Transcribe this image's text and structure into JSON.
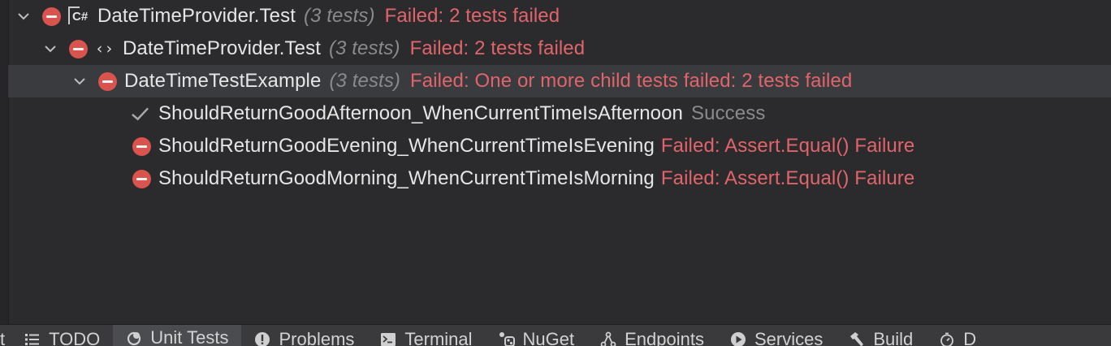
{
  "tree": {
    "rows": [
      {
        "name": "DateTimeProvider.Test",
        "count": "(3 tests)",
        "status": "Failed: 2 tests failed",
        "icon": "csharp-project-icon"
      },
      {
        "name": "DateTimeProvider.Test",
        "count": "(3 tests)",
        "status": "Failed: 2 tests failed",
        "icon": "namespace-icon"
      },
      {
        "name": "DateTimeTestExample",
        "count": "(3 tests)",
        "status": "Failed: One or more child tests failed: 2 tests failed",
        "selected": true
      },
      {
        "name": "ShouldReturnGoodAfternoon_WhenCurrentTimeIsAfternoon",
        "status": "Success",
        "result": "pass"
      },
      {
        "name": "ShouldReturnGoodEvening_WhenCurrentTimeIsEvening",
        "status": "Failed: Assert.Equal() Failure",
        "result": "fail"
      },
      {
        "name": "ShouldReturnGoodMorning_WhenCurrentTimeIsMorning",
        "status": "Failed: Assert.Equal() Failure",
        "result": "fail"
      }
    ]
  },
  "statusbar": {
    "cut_left": "t",
    "tools": [
      {
        "label": "TODO",
        "icon": "list-icon"
      },
      {
        "label": "Unit Tests",
        "icon": "unit-tests-icon",
        "active": true
      },
      {
        "label": "Problems",
        "icon": "problems-icon"
      },
      {
        "label": "Terminal",
        "icon": "terminal-icon"
      },
      {
        "label": "NuGet",
        "icon": "nuget-icon"
      },
      {
        "label": "Endpoints",
        "icon": "endpoints-icon"
      },
      {
        "label": "Services",
        "icon": "services-icon"
      },
      {
        "label": "Build",
        "icon": "hammer-icon"
      },
      {
        "label": "D",
        "icon": "stopwatch-icon"
      }
    ]
  },
  "colors": {
    "fail": "#e0656b",
    "fail_icon": "#d9534f",
    "muted": "#8a8a8a",
    "background": "#2b2b2d",
    "selected_row": "#3a3b3e"
  }
}
